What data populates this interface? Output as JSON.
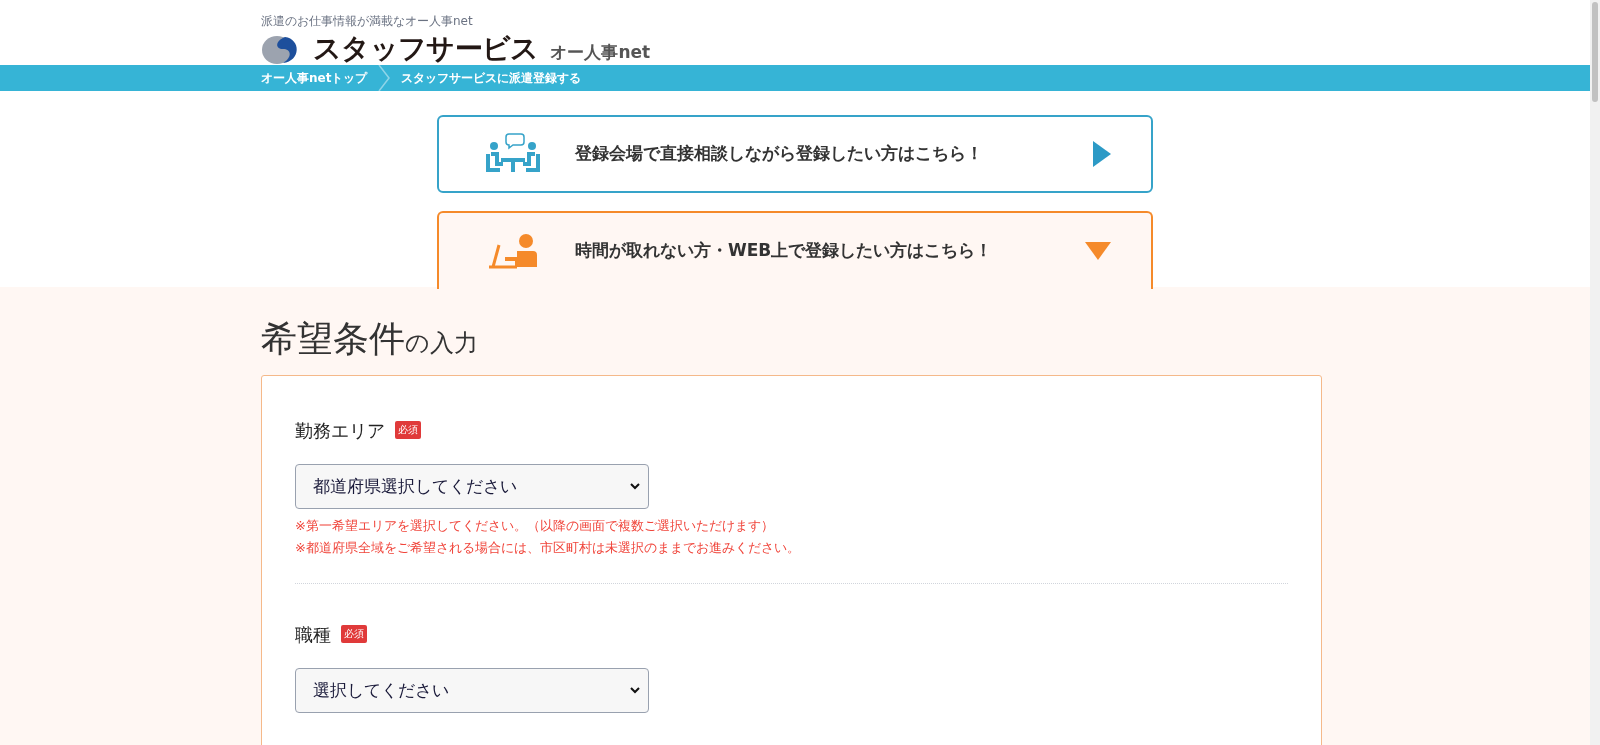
{
  "header": {
    "tagline": "派遣のお仕事情報が満載なオー人事net",
    "logo_text": "スタッフサービス",
    "logo_subtext": "オー人事net"
  },
  "breadcrumbs": [
    {
      "label": "オー人事netトップ"
    },
    {
      "label": "スタッフサービスに派遣登録する"
    }
  ],
  "options": [
    {
      "kind": "venue",
      "label": "登録会場で直接相談しながら登録したい方はこちら！",
      "expanded": false
    },
    {
      "kind": "web",
      "label": "時間が取れない方・WEB上で登録したい方はこちら！",
      "expanded": true
    }
  ],
  "heading": {
    "main": "希望条件",
    "suffix": "の入力"
  },
  "fields": [
    {
      "label": "勤務エリア",
      "badge": "必須",
      "value": "都道府県選択してください",
      "notes": [
        "※第一希望エリアを選択してください。（以降の画面で複数ご選択いただけます）",
        "※都道府県全域をご希望される場合には、市区町村は未選択のままでお進みください。"
      ]
    },
    {
      "label": "職種",
      "badge": "必須",
      "value": "選択してください"
    }
  ]
}
